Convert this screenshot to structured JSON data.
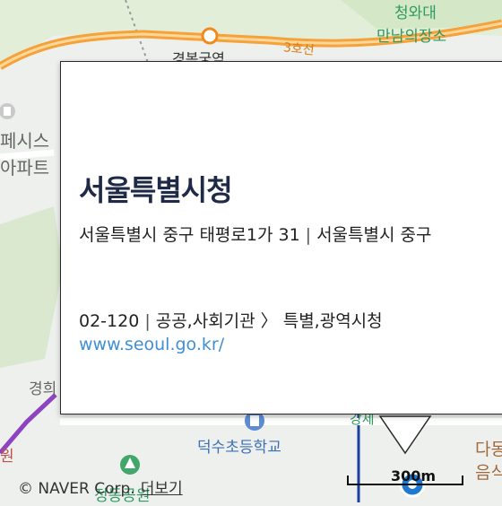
{
  "map": {
    "road_label": "3호선",
    "labels": {
      "cheongwadae": "청와대",
      "manmin": "만남의장소",
      "gyeongbok": "경복궁역",
      "apt_a": "페시스",
      "apt_b": "아파트",
      "gyeong": "경희",
      "won": "원",
      "deoksu": "덕수초등학교",
      "park": "정동공원",
      "dam": "다동",
      "eumsik": "음식문",
      "gang": "강세"
    }
  },
  "card": {
    "title": "서울특별시청",
    "address_lot": "서울특별시 중구 태평로1가 31",
    "address_road": "서울특별시 중구",
    "phone": "02-120",
    "category": "공공,사회기관 〉 특별,광역시청",
    "website": "www.seoul.go.kr/"
  },
  "footer": {
    "copyright": "© NAVER Corp.",
    "more_link": "더보기"
  },
  "scale": {
    "label": "300m"
  },
  "colors": {
    "highway": "#f5a23a",
    "subway_line3": "#f08a1f",
    "marker": "#1f78d1",
    "link": "#3f8fd6"
  }
}
